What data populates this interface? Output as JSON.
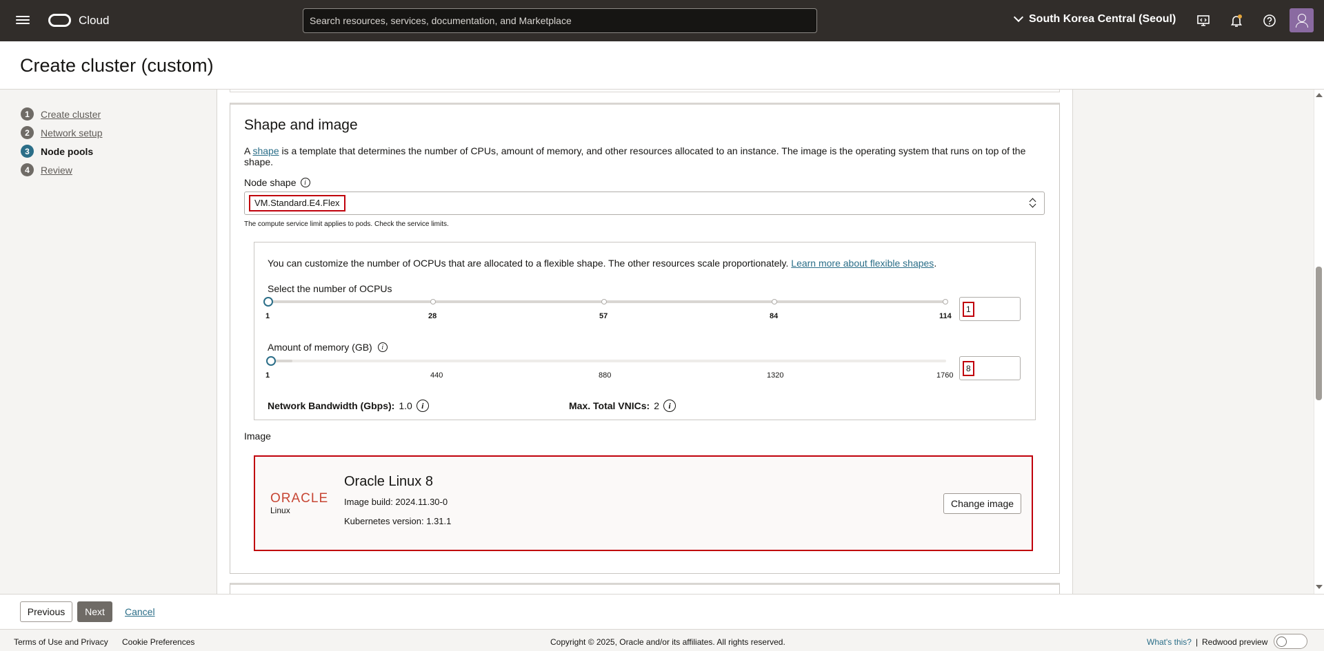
{
  "topbar": {
    "brand": "Cloud",
    "search_placeholder": "Search resources, services, documentation, and Marketplace",
    "region": "South Korea Central (Seoul)"
  },
  "page": {
    "title": "Create cluster (custom)"
  },
  "steps": [
    {
      "num": "1",
      "label": "Create cluster"
    },
    {
      "num": "2",
      "label": "Network setup"
    },
    {
      "num": "3",
      "label": "Node pools"
    },
    {
      "num": "4",
      "label": "Review"
    }
  ],
  "shape_section": {
    "title": "Shape and image",
    "desc_prefix": "A ",
    "desc_link": "shape",
    "desc_rest": " is a template that determines the number of CPUs, amount of memory, and other resources allocated to an instance. The image is the operating system that runs on top of the shape.",
    "node_shape_label": "Node shape",
    "node_shape_value": "VM.Standard.E4.Flex",
    "hint": "The compute service limit applies to pods. Check the service limits.",
    "flex_desc": "You can customize the number of OCPUs that are allocated to a flexible shape. The other resources scale proportionately. ",
    "flex_link": "Learn more about flexible shapes",
    "flex_period": ".",
    "ocpu_label": "Select the number of OCPUs",
    "ocpu_ticks": [
      "1",
      "28",
      "57",
      "84",
      "114"
    ],
    "ocpu_value": "1",
    "memory_label": "Amount of memory (GB)",
    "memory_ticks": [
      "1",
      "440",
      "880",
      "1320",
      "1760"
    ],
    "memory_value": "8",
    "bandwidth_label": "Network Bandwidth (Gbps):",
    "bandwidth_value": "1.0",
    "vnics_label": "Max. Total VNICs:",
    "vnics_value": "2",
    "image_label": "Image",
    "image": {
      "logo": "ORACLE",
      "logo_sub": "Linux",
      "name": "Oracle Linux 8",
      "build": "Image build: 2024.11.30-0",
      "k8s": "Kubernetes version: 1.31.1",
      "change_button": "Change image"
    }
  },
  "actions": {
    "previous": "Previous",
    "next": "Next",
    "cancel": "Cancel"
  },
  "footer": {
    "terms": "Terms of Use and Privacy",
    "cookies": "Cookie Preferences",
    "copyright": "Copyright © 2025, Oracle and/or its affiliates. All rights reserved.",
    "whats_this": "What's this?",
    "separator": "|",
    "redwood": "Redwood preview"
  },
  "colors": {
    "topbar": "#312d2a",
    "accent": "#2b6e88",
    "highlight": "#c0000b",
    "oracle_red": "#c74634"
  }
}
